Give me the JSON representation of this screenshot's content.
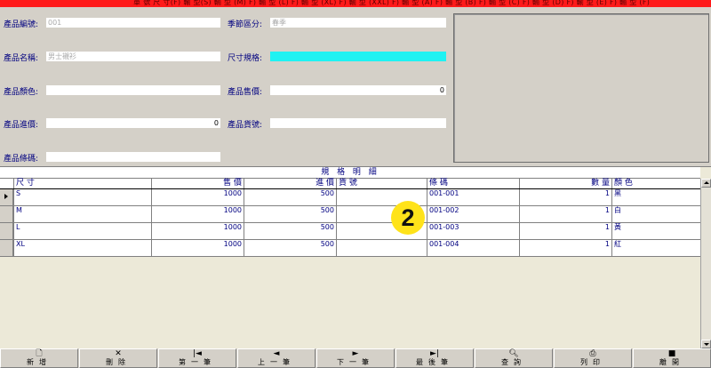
{
  "top_banner": "單 號 尺 寸(F) 輸 型(S) 輸 型 (M) F) 輸 型 (L) F) 輸 型 (XL) F) 輸 型 (XXL) F) 輸 型 (A) F) 輸 型 (B) F) 輸 型 (C) F) 輸 型 (D) F) 輸 型 (E) F) 輸 型 (F)",
  "form": {
    "product_no": {
      "label": "產品編號:",
      "value": "001"
    },
    "season": {
      "label": "季節區分:",
      "value": "春季"
    },
    "product_name": {
      "label": "產品名稱:",
      "value": "男士襯衫"
    },
    "size_spec": {
      "label": "尺寸規格:",
      "value": ""
    },
    "color": {
      "label": "產品顏色:",
      "value": ""
    },
    "sale_price": {
      "label": "產品售價:",
      "value": "0"
    },
    "cost_price": {
      "label": "產品進價:",
      "value": "0"
    },
    "goods_no": {
      "label": "產品貨號:",
      "value": ""
    },
    "barcode": {
      "label": "產品條碼:",
      "value": ""
    }
  },
  "grid": {
    "title": "規 格 明 細",
    "columns": [
      "尺 寸",
      "售 價",
      "進 價",
      "貨 號",
      "條 碼",
      "數 量",
      "顏 色"
    ],
    "rows": [
      {
        "size": "S",
        "price": "1000",
        "cost": "500",
        "goods": "",
        "barcode": "001-001",
        "qty": "1",
        "color": "黑"
      },
      {
        "size": "M",
        "price": "1000",
        "cost": "500",
        "goods": "",
        "barcode": "001-002",
        "qty": "1",
        "color": "白"
      },
      {
        "size": "L",
        "price": "1000",
        "cost": "500",
        "goods": "",
        "barcode": "001-003",
        "qty": "1",
        "color": "黃"
      },
      {
        "size": "XL",
        "price": "1000",
        "cost": "500",
        "goods": "",
        "barcode": "001-004",
        "qty": "1",
        "color": "紅"
      }
    ]
  },
  "badge": "2",
  "toolbar": [
    {
      "label": "新增",
      "icon": "new-page-icon"
    },
    {
      "label": "刪除",
      "icon": "delete-x-icon"
    },
    {
      "label": "第一筆",
      "icon": "first-record-icon"
    },
    {
      "label": "上一筆",
      "icon": "prev-record-icon"
    },
    {
      "label": "下一筆",
      "icon": "next-record-icon"
    },
    {
      "label": "最後筆",
      "icon": "last-record-icon"
    },
    {
      "label": "查詢",
      "icon": "query-magnifier-icon"
    },
    {
      "label": "列印",
      "icon": "printer-icon"
    },
    {
      "label": "離開",
      "icon": "exit-save-icon"
    }
  ]
}
